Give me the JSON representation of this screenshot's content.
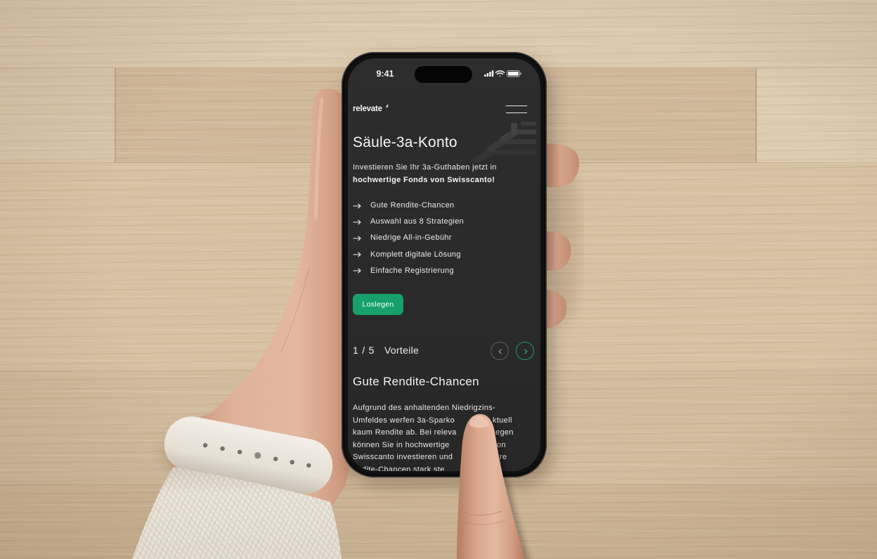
{
  "status_bar": {
    "time": "9:41"
  },
  "header": {
    "logo": "relevate"
  },
  "hero": {
    "title": "Säule-3a-Konto",
    "intro": "Investieren Sie Ihr 3a-Guthaben jetzt in",
    "intro_bold": "hochwertige Fonds von Swisscanto!",
    "features": [
      "Gute Rendite-Chancen",
      "Auswahl aus 8 Strategien",
      "Niedrige All-in-Gebühr",
      "Komplett digitale Lösung",
      "Einfache Registrierung"
    ],
    "cta_label": "Loslegen"
  },
  "benefits": {
    "counter": "1 / 5",
    "label": "Vorteile",
    "slide_title": "Gute Rendite-Chancen",
    "slide_text_lines": [
      {
        "left": "Aufgrund des anhaltenden Niedrigzins-"
      },
      {
        "left": "Umfeldes werfen 3a-Sparko",
        "right": "ktuell"
      },
      {
        "left": "kaum Rendite ab. Bei releva",
        "right": "egen"
      },
      {
        "left": "können Sie in hochwertige",
        "right": "on"
      },
      {
        "left": "Swisscanto investieren und",
        "right": "re"
      },
      {
        "left": "dite-Chancen stark ste"
      }
    ]
  },
  "icons": {
    "menu": "hamburger-menu-icon",
    "list_bullet": "arrow-right-icon",
    "prev": "chevron-left-icon",
    "next": "chevron-right-icon",
    "status": [
      "cellular-signal-icon",
      "wifi-icon",
      "battery-icon"
    ]
  },
  "colors": {
    "accent": "#17a06b",
    "screen_background": "#2a2a2a",
    "text": "#f0f0f0"
  }
}
